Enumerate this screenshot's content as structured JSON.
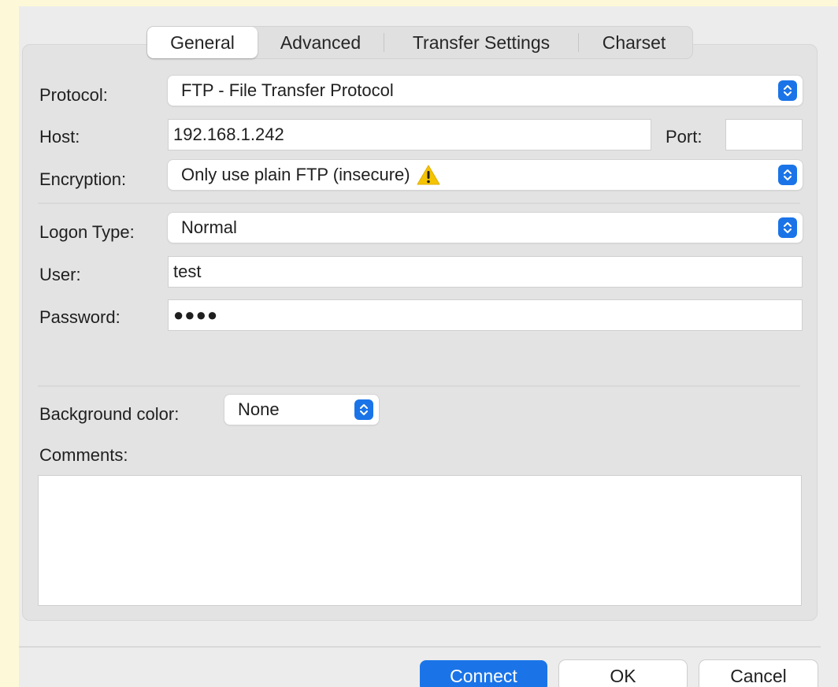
{
  "tabs": [
    {
      "label": "General",
      "active": true
    },
    {
      "label": "Advanced",
      "active": false
    },
    {
      "label": "Transfer Settings",
      "active": false
    },
    {
      "label": "Charset",
      "active": false
    }
  ],
  "form": {
    "protocol_label": "Protocol:",
    "protocol_value": "FTP - File Transfer Protocol",
    "host_label": "Host:",
    "host_value": "192.168.1.242",
    "port_label": "Port:",
    "port_value": "",
    "encryption_label": "Encryption:",
    "encryption_value": "Only use plain FTP (insecure)",
    "logon_type_label": "Logon Type:",
    "logon_type_value": "Normal",
    "user_label": "User:",
    "user_value": "test",
    "password_label": "Password:",
    "password_value": "●●●●",
    "background_color_label": "Background color:",
    "background_color_value": "None",
    "comments_label": "Comments:",
    "comments_value": ""
  },
  "buttons": {
    "connect": "Connect",
    "ok": "OK",
    "cancel": "Cancel"
  },
  "colors": {
    "accent": "#1a74e8",
    "warning": "#f5c400"
  },
  "icons": {
    "warning": "warning-triangle-icon",
    "stepper": "up-down-chevron-icon"
  }
}
